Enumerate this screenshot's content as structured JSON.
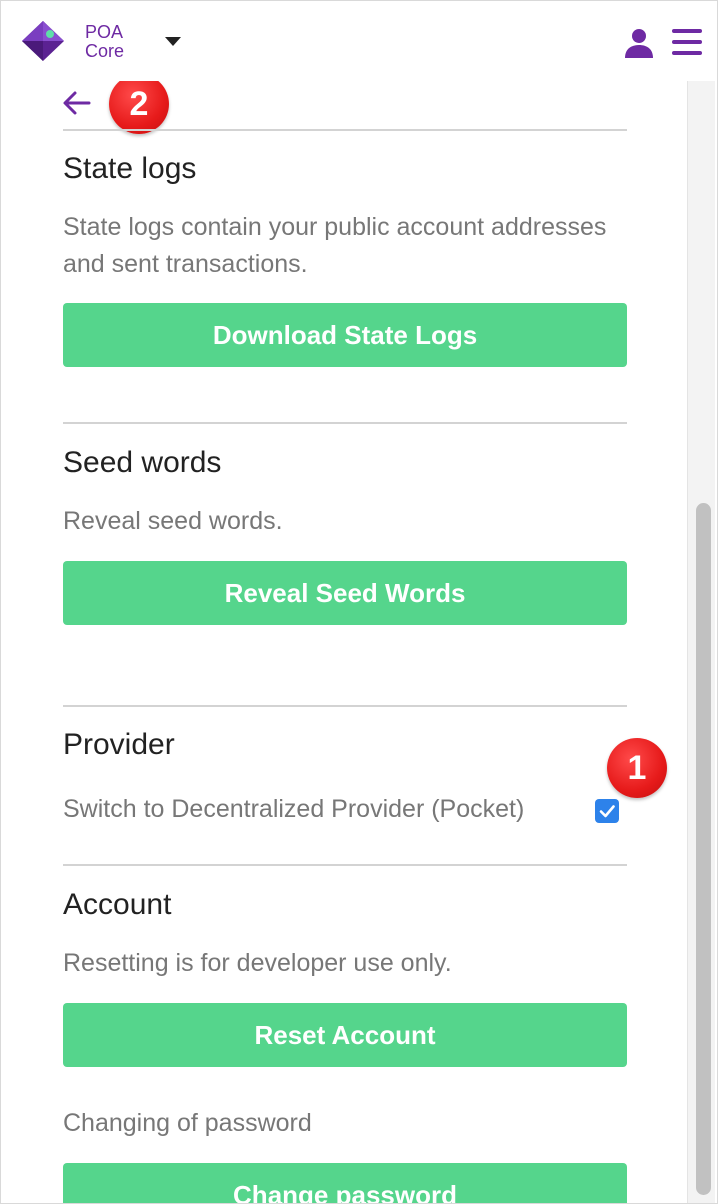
{
  "header": {
    "network_line1": "POA",
    "network_line2": "Core"
  },
  "annotations": {
    "badge_1": "1",
    "badge_2": "2"
  },
  "state_logs": {
    "title": "State logs",
    "description": "State logs contain your public account addresses and sent transactions.",
    "button": "Download State Logs"
  },
  "seed_words": {
    "title": "Seed words",
    "description": "Reveal seed words.",
    "button": "Reveal Seed Words"
  },
  "provider": {
    "title": "Provider",
    "toggle_label": "Switch to Decentralized Provider (Pocket)",
    "checked": true
  },
  "account": {
    "title": "Account",
    "description": "Resetting is for developer use only.",
    "button": "Reset Account"
  },
  "password": {
    "label": "Changing of password",
    "button": "Change password"
  },
  "colors": {
    "brand": "#6e2aa3",
    "button": "#55d58c",
    "checkbox": "#2d82ea",
    "badge": "#e61a1a"
  }
}
